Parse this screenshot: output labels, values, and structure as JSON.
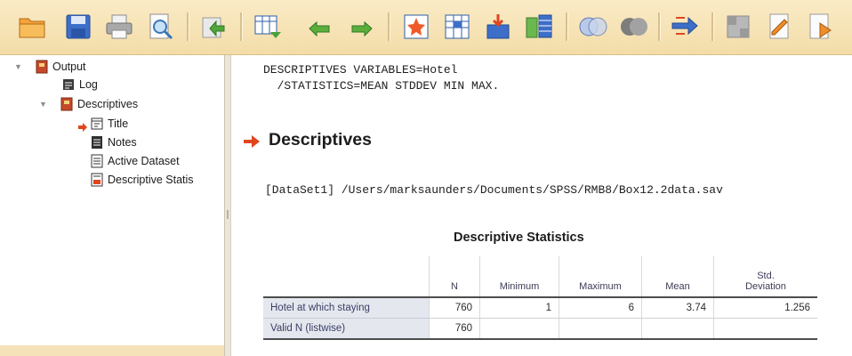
{
  "toolbar": {
    "icons": [
      "open-folder",
      "save",
      "print",
      "print-preview",
      "export",
      "goto-data",
      "undo",
      "redo",
      "goto-case",
      "goto-variable",
      "insert-variable",
      "split-file",
      "select-cases",
      "value-labels",
      "use-sets",
      "show-all-variables",
      "spell-check",
      "run-script",
      "designate-window"
    ]
  },
  "navigator": {
    "items": [
      {
        "label": "Output",
        "icon": "output-book-icon"
      },
      {
        "label": "Log",
        "icon": "log-icon"
      },
      {
        "label": "Descriptives",
        "icon": "descriptives-book-icon"
      },
      {
        "label": "Title",
        "icon": "title-icon"
      },
      {
        "label": "Notes",
        "icon": "notes-icon"
      },
      {
        "label": "Active Dataset",
        "icon": "active-dataset-icon"
      },
      {
        "label": "Descriptive Statis",
        "icon": "descriptive-statistics-icon"
      }
    ]
  },
  "output": {
    "syntax_line1": "DESCRIPTIVES VARIABLES=Hotel",
    "syntax_line2": "  /STATISTICS=MEAN STDDEV MIN MAX.",
    "heading": "Descriptives",
    "dataset_line": "[DataSet1] /Users/marksaunders/Documents/SPSS/RMB8/Box12.2data.sav",
    "table_title": "Descriptive Statistics",
    "columns": {
      "n": "N",
      "minimum": "Minimum",
      "maximum": "Maximum",
      "mean": "Mean",
      "std_line1": "Std.",
      "std_line2": "Deviation"
    },
    "rows": [
      {
        "label": "Hotel at which staying",
        "n": "760",
        "minimum": "1",
        "maximum": "6",
        "mean": "3.74",
        "std": "1.256"
      },
      {
        "label": "Valid N (listwise)",
        "n": "760",
        "minimum": "",
        "maximum": "",
        "mean": "",
        "std": ""
      }
    ]
  },
  "colors": {
    "toolbar_bg": "#f6e2b8",
    "accent_red": "#e0451e",
    "row_label_bg": "#e4e7ee"
  }
}
